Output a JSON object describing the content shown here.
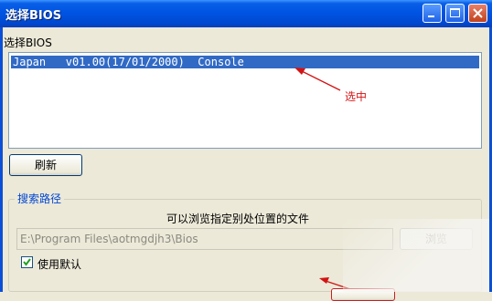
{
  "window": {
    "title": "选择BIOS"
  },
  "list": {
    "label": "选择BIOS",
    "selected_row": "Japan   v01.00(17/01/2000)  Console"
  },
  "annotation": {
    "text": "选中",
    "color": "#d21414"
  },
  "buttons": {
    "refresh": "刷新",
    "browse": "浏览"
  },
  "search_path": {
    "group_title": "搜索路径",
    "hint": "可以浏览指定别处位置的文件",
    "path_value": "E:\\Program Files\\aotmgdjh3\\Bios",
    "use_default_label": "使用默认",
    "use_default_checked": true
  },
  "colors": {
    "titlebar": "#0054e3",
    "selection": "#316ac5",
    "group_title": "#0046d5",
    "dialog_bg": "#ece9d8"
  },
  "icons": [
    "minimize-icon",
    "maximize-icon",
    "close-icon",
    "checkmark-icon",
    "red-arrow-icon"
  ]
}
